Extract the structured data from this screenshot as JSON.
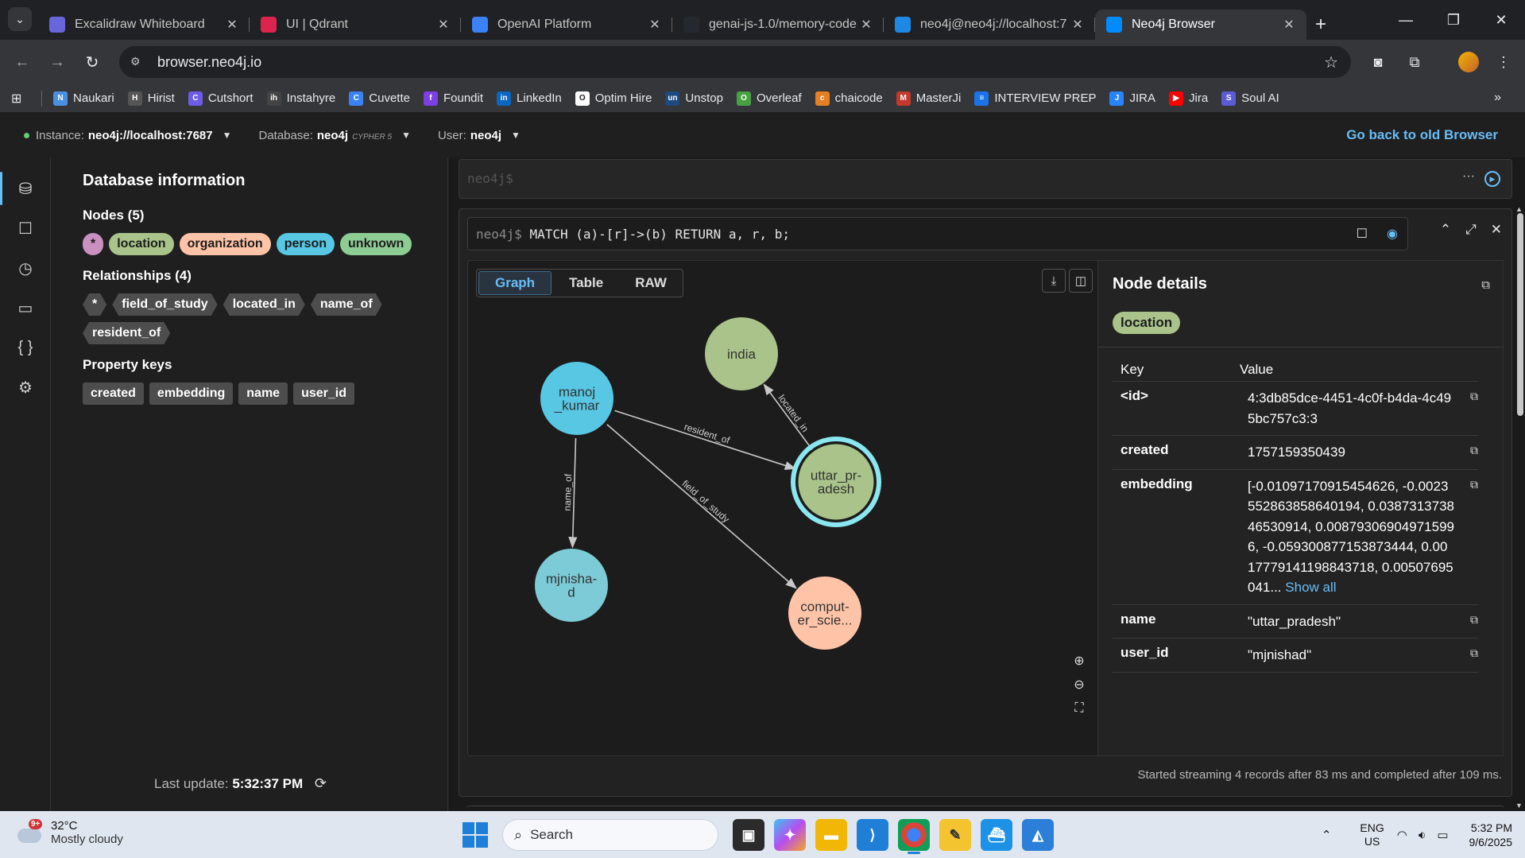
{
  "browser": {
    "tabs": [
      {
        "title": "Excalidraw Whiteboard",
        "icon": "excalidraw-icon",
        "color": "#6965db"
      },
      {
        "title": "UI | Qdrant",
        "icon": "qdrant-icon",
        "color": "#dc244c"
      },
      {
        "title": "OpenAI Platform",
        "icon": "openai-icon",
        "color": "#3b82f6"
      },
      {
        "title": "genai-js-1.0/memory-code",
        "icon": "github-icon",
        "color": "#24292f"
      },
      {
        "title": "neo4j@neo4j://localhost:7",
        "icon": "terminal-icon",
        "color": "#1e88e5"
      },
      {
        "title": "Neo4j Browser",
        "icon": "neo4j-icon",
        "color": "#018bff"
      }
    ],
    "url": "browser.neo4j.io",
    "bookmarks": [
      {
        "label": "Naukari",
        "color": "#4a90e2",
        "glyph": "N"
      },
      {
        "label": "Hirist",
        "color": "#555555",
        "glyph": "H"
      },
      {
        "label": "Cutshort",
        "color": "#6c5ce7",
        "glyph": "C"
      },
      {
        "label": "Instahyre",
        "color": "#444444",
        "glyph": "ih"
      },
      {
        "label": "Cuvette",
        "color": "#3b82f6",
        "glyph": "C"
      },
      {
        "label": "Foundit",
        "color": "#7b3fe4",
        "glyph": "f"
      },
      {
        "label": "LinkedIn",
        "color": "#0a66c2",
        "glyph": "in"
      },
      {
        "label": "Optim Hire",
        "color": "#ffffff",
        "glyph": "O"
      },
      {
        "label": "Unstop",
        "color": "#1c4980",
        "glyph": "un"
      },
      {
        "label": "Overleaf",
        "color": "#47a141",
        "glyph": "O"
      },
      {
        "label": "chaicode",
        "color": "#e67e22",
        "glyph": "c"
      },
      {
        "label": "MasterJi",
        "color": "#c0392b",
        "glyph": "M"
      },
      {
        "label": "INTERVIEW PREP",
        "color": "#1a73e8",
        "glyph": "≡"
      },
      {
        "label": "JIRA",
        "color": "#2684ff",
        "glyph": "J"
      },
      {
        "label": "Jira",
        "color": "#ff0000",
        "glyph": "▶"
      },
      {
        "label": "Soul AI",
        "color": "#5b5bd6",
        "glyph": "S"
      }
    ]
  },
  "neo4j": {
    "instance_label": "Instance:",
    "instance_value": "neo4j://localhost:7687",
    "database_label": "Database:",
    "database_value": "neo4j",
    "cypher_version": "CYPHER 5",
    "user_label": "User:",
    "user_value": "neo4j",
    "old_browser_link": "Go back to old Browser"
  },
  "dbinfo": {
    "title": "Database information",
    "nodes_heading": "Nodes (5)",
    "node_labels": [
      {
        "label": "*",
        "color": "#c990c0"
      },
      {
        "label": "location",
        "color": "#a9c38a"
      },
      {
        "label": "organization",
        "color": "#ffc4a8"
      },
      {
        "label": "person",
        "color": "#57c7e3"
      },
      {
        "label": "unknown",
        "color": "#8dcc93"
      }
    ],
    "relationships_heading": "Relationships (4)",
    "relationships": [
      "*",
      "field_of_study",
      "located_in",
      "name_of",
      "resident_of"
    ],
    "property_keys_heading": "Property keys",
    "property_keys": [
      "created",
      "embedding",
      "name",
      "user_id"
    ],
    "last_update_label": "Last update:",
    "last_update_time": "5:32:37 PM"
  },
  "editor": {
    "prompt": "neo4j$"
  },
  "frame": {
    "prompt": "neo4j$",
    "query": "MATCH (a)-[r]->(b) RETURN a, r, b;",
    "view_tabs": [
      "Graph",
      "Table",
      "RAW"
    ],
    "active_view": "Graph",
    "status": "Started streaming 4 records after 83 ms and completed after 109 ms."
  },
  "graph": {
    "nodes": [
      {
        "id": "india",
        "lines": [
          "india"
        ],
        "color": "#a9c38a",
        "selected": false
      },
      {
        "id": "manoj",
        "lines": [
          "manoj",
          "_kumar"
        ],
        "color": "#57c7e3",
        "selected": false
      },
      {
        "id": "uttar",
        "lines": [
          "uttar_pr-",
          "adesh"
        ],
        "color": "#a9c38a",
        "selected": true
      },
      {
        "id": "mjnishad",
        "lines": [
          "mjnisha-",
          "d"
        ],
        "color": "#7ccbd6",
        "selected": false
      },
      {
        "id": "computer",
        "lines": [
          "comput-",
          "er_scie..."
        ],
        "color": "#ffc4a8",
        "selected": false
      }
    ],
    "edges": [
      {
        "from": "uttar",
        "to": "india",
        "label": "located_in"
      },
      {
        "from": "manoj",
        "to": "uttar",
        "label": "resident_of"
      },
      {
        "from": "manoj",
        "to": "mjnishad",
        "label": "name_of"
      },
      {
        "from": "manoj",
        "to": "computer",
        "label": "field_of_study"
      }
    ]
  },
  "details": {
    "title": "Node details",
    "label": "location",
    "key_header": "Key",
    "value_header": "Value",
    "rows": [
      {
        "key": "<id>",
        "value": "4:3db85dce-4451-4c0f-b4da-4c495bc757c3:3"
      },
      {
        "key": "created",
        "value": "1757159350439"
      },
      {
        "key": "embedding",
        "value": "[-0.01097170915454626, -0.0023552863858640194, 0.038731373846530914, 0.008793069049715996, -0.059300877153873444, 0.0017779141198843718, 0.00507695041...",
        "show_all": "Show all"
      },
      {
        "key": "name",
        "value": "\"uttar_pradesh\""
      },
      {
        "key": "user_id",
        "value": "\"mjnishad\""
      }
    ]
  },
  "taskbar": {
    "weather_temp": "32°C",
    "weather_desc": "Mostly cloudy",
    "weather_badge": "9+",
    "search_placeholder": "Search",
    "lang_top": "ENG",
    "lang_bottom": "US",
    "time": "5:32 PM",
    "date": "9/6/2025"
  }
}
